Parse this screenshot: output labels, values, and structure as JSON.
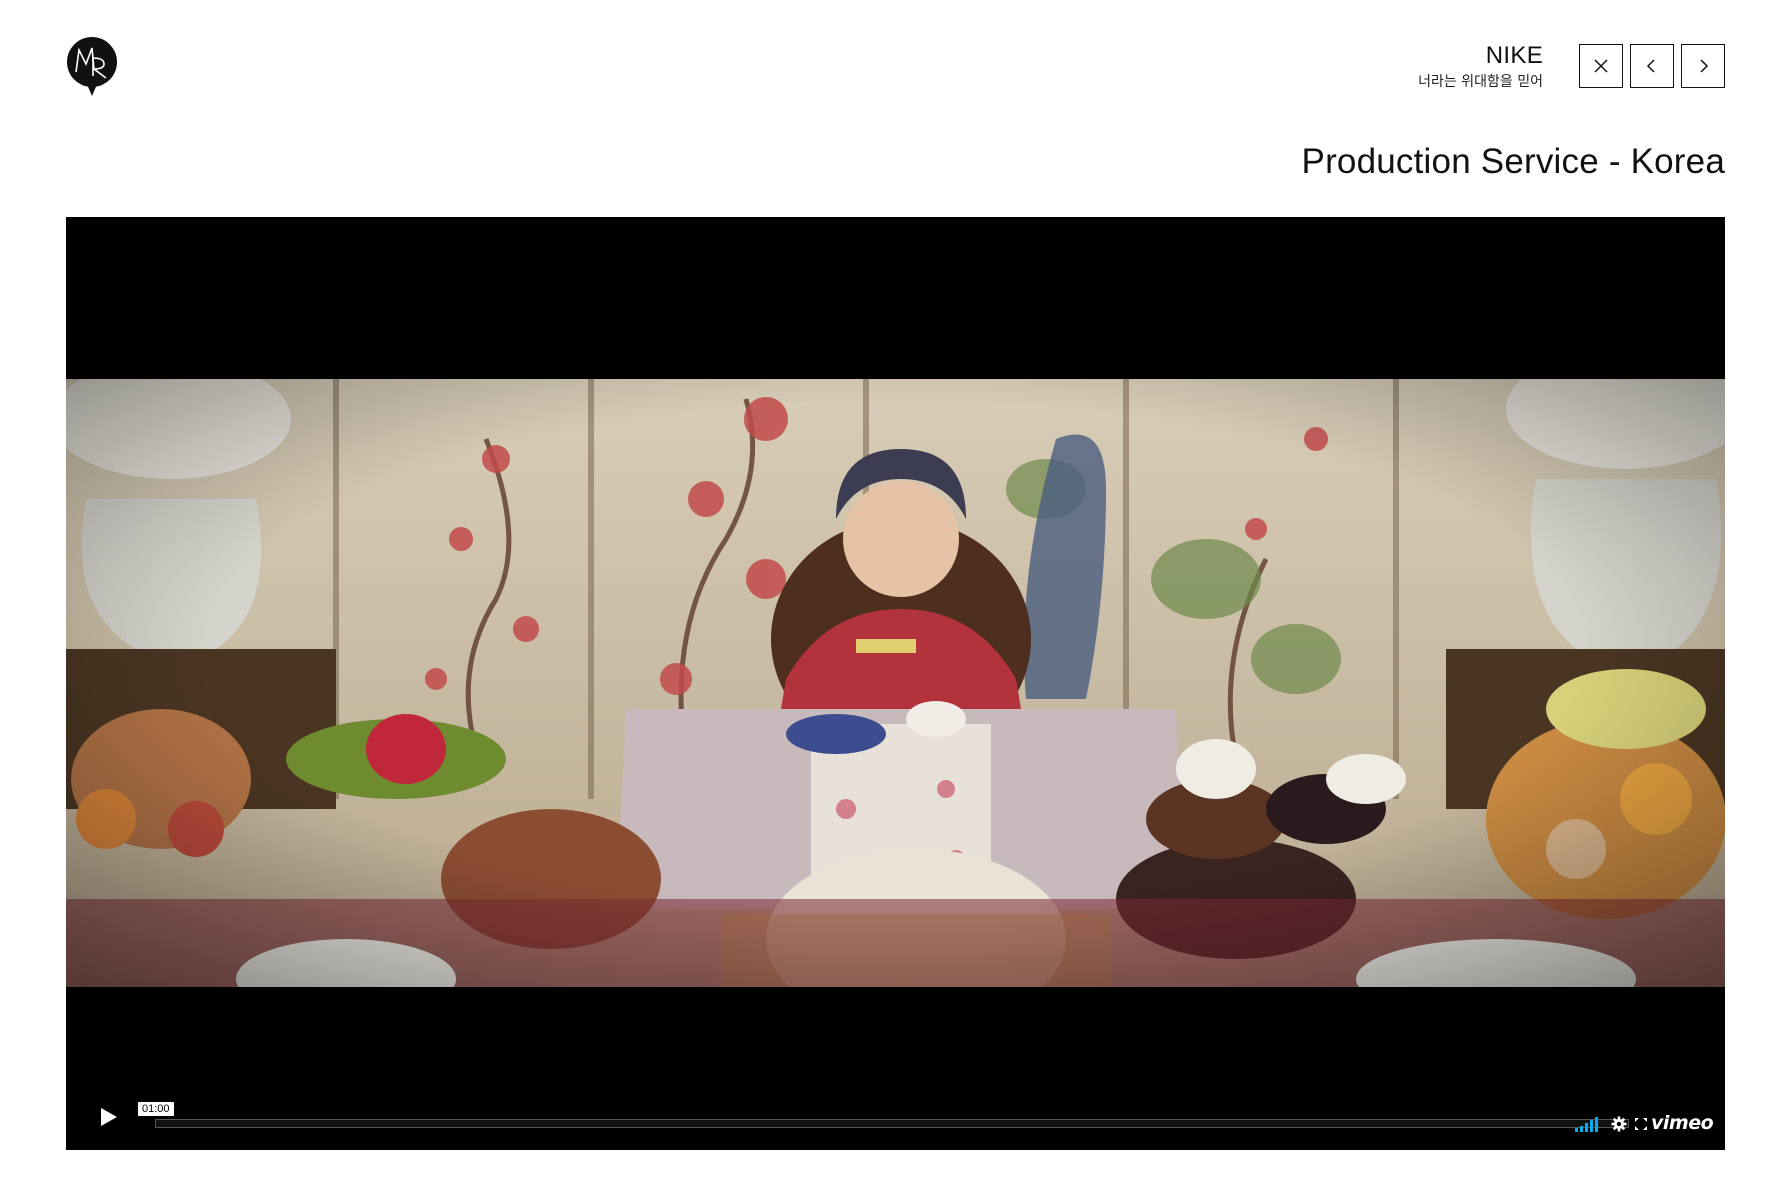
{
  "brand": {
    "logo_icon": "mr-logo-icon"
  },
  "project": {
    "client": "NIKE",
    "subtitle": "너라는 위대함을 믿어"
  },
  "nav": {
    "close_icon": "close-icon",
    "prev_icon": "chevron-left-icon",
    "next_icon": "chevron-right-icon"
  },
  "page": {
    "heading": "Production Service - Korea"
  },
  "video": {
    "timecode": "01:00",
    "progress": 0,
    "play_icon": "play-icon",
    "volume_icon": "volume-icon",
    "settings_icon": "gear-icon",
    "fullscreen_icon": "fullscreen-icon",
    "provider_logo": "vimeo",
    "accent_color": "#00adef"
  }
}
